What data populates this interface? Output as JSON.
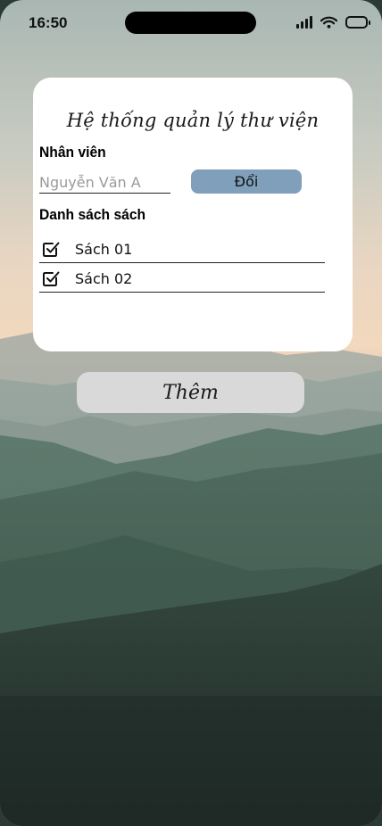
{
  "status_bar": {
    "time": "16:50",
    "icons": [
      "cellular-signal-icon",
      "wifi-icon",
      "battery-icon"
    ]
  },
  "card": {
    "title": "Hệ thống quản lý thư viện",
    "employee_label": "Nhân viên",
    "name_input": {
      "value": "",
      "placeholder": "Nguyễn Văn A"
    },
    "change_button": "Đổi",
    "book_list_label": "Danh sách sách",
    "books": [
      {
        "name": "Sách 01",
        "checked": true,
        "icon": "checkbox-checked-icon"
      },
      {
        "name": "Sách 02",
        "checked": true,
        "icon": "checkbox-checked-icon"
      }
    ]
  },
  "add_button": "Thêm",
  "colors": {
    "card_background": "#ffffff",
    "change_button": "#7f9fba",
    "add_button": "#d9d9d9",
    "text": "#111111"
  }
}
